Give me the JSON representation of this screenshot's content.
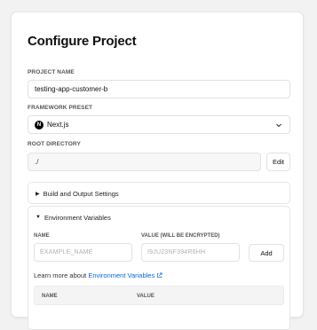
{
  "page": {
    "title": "Configure Project"
  },
  "project_name": {
    "label": "PROJECT NAME",
    "value": "testing-app-customer-b"
  },
  "framework": {
    "label": "FRAMEWORK PRESET",
    "value": "Next.js",
    "logo_letter": "N",
    "chevron_icon": "chevron-down-icon"
  },
  "root_directory": {
    "label": "ROOT DIRECTORY",
    "value": "./",
    "edit_label": "Edit"
  },
  "build_section": {
    "title": "Build and Output Settings",
    "state": "collapsed"
  },
  "env_section": {
    "title": "Environment Variables",
    "state": "expanded",
    "name_label": "NAME",
    "value_label": "VALUE (WILL BE ENCRYPTED)",
    "name_placeholder": "EXAMPLE_NAME",
    "value_placeholder": "I9JU23NF394R6HH",
    "add_label": "Add",
    "learn_prefix": "Learn more about",
    "learn_link": "Environment Variables",
    "table_headers": [
      "NAME",
      "VALUE"
    ]
  },
  "colors": {
    "link": "#0a66d8",
    "background": "#f2f2f2",
    "card": "#ffffff"
  }
}
